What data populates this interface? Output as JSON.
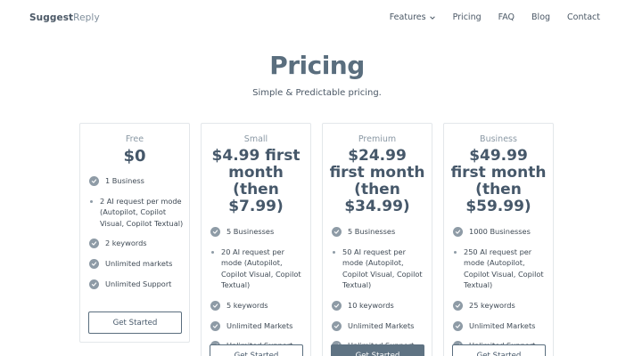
{
  "brand": {
    "part1": "Suggest",
    "part2": "Reply"
  },
  "nav": {
    "features": "Features",
    "pricing": "Pricing",
    "faq": "FAQ",
    "blog": "Blog",
    "contact": "Contact"
  },
  "hero": {
    "title": "Pricing",
    "subtitle": "Simple & Predictable pricing."
  },
  "plans": [
    {
      "name": "Free",
      "price": "$0",
      "features": [
        {
          "bullet": "check",
          "text": "1 Business"
        },
        {
          "bullet": "dot",
          "text": "2 AI request per mode (Autopilot, Copilot Visual, Copilot Textual)"
        },
        {
          "bullet": "check",
          "text": "2 keywords"
        },
        {
          "bullet": "check",
          "text": "Unlimited markets"
        },
        {
          "bullet": "check",
          "text": "Unlimited Support"
        }
      ],
      "button": "Get Started"
    },
    {
      "name": "Small",
      "price": "$4.99 first month (then $7.99)",
      "features": [
        {
          "bullet": "check",
          "text": "5 Businesses"
        },
        {
          "bullet": "dot",
          "text": "20 AI request per mode (Autopilot, Copilot Visual, Copilot Textual)"
        },
        {
          "bullet": "check",
          "text": "5 keywords"
        },
        {
          "bullet": "check",
          "text": "Unlimited Markets"
        },
        {
          "bullet": "check",
          "text": "Unlimited Support"
        }
      ],
      "button": "Get Started"
    },
    {
      "name": "Premium",
      "price": "$24.99 first month (then $34.99)",
      "features": [
        {
          "bullet": "check",
          "text": "5 Businesses"
        },
        {
          "bullet": "dot",
          "text": "50 AI request per mode (Autopilot, Copilot Visual, Copilot Textual)"
        },
        {
          "bullet": "check",
          "text": "10 keywords"
        },
        {
          "bullet": "check",
          "text": "Unlimited Markets"
        },
        {
          "bullet": "check",
          "text": "Unlimited Support"
        }
      ],
      "button": "Get Started"
    },
    {
      "name": "Business",
      "price": "$49.99 first month (then $59.99)",
      "features": [
        {
          "bullet": "check",
          "text": "1000 Businesses"
        },
        {
          "bullet": "dot",
          "text": "250 AI request per mode (Autopilot, Copilot Visual, Copilot Textual)"
        },
        {
          "bullet": "check",
          "text": "25 keywords"
        },
        {
          "bullet": "check",
          "text": "Unlimited Markets"
        },
        {
          "bullet": "check",
          "text": "Unlimited Support"
        }
      ],
      "button": "Get Started"
    }
  ],
  "icons": {
    "check": "check-icon",
    "chevron": "chevron-down-icon"
  },
  "colors": {
    "accent": "#5f7383",
    "title": "#5a6e7e",
    "bullet": "#8e9ba6"
  }
}
